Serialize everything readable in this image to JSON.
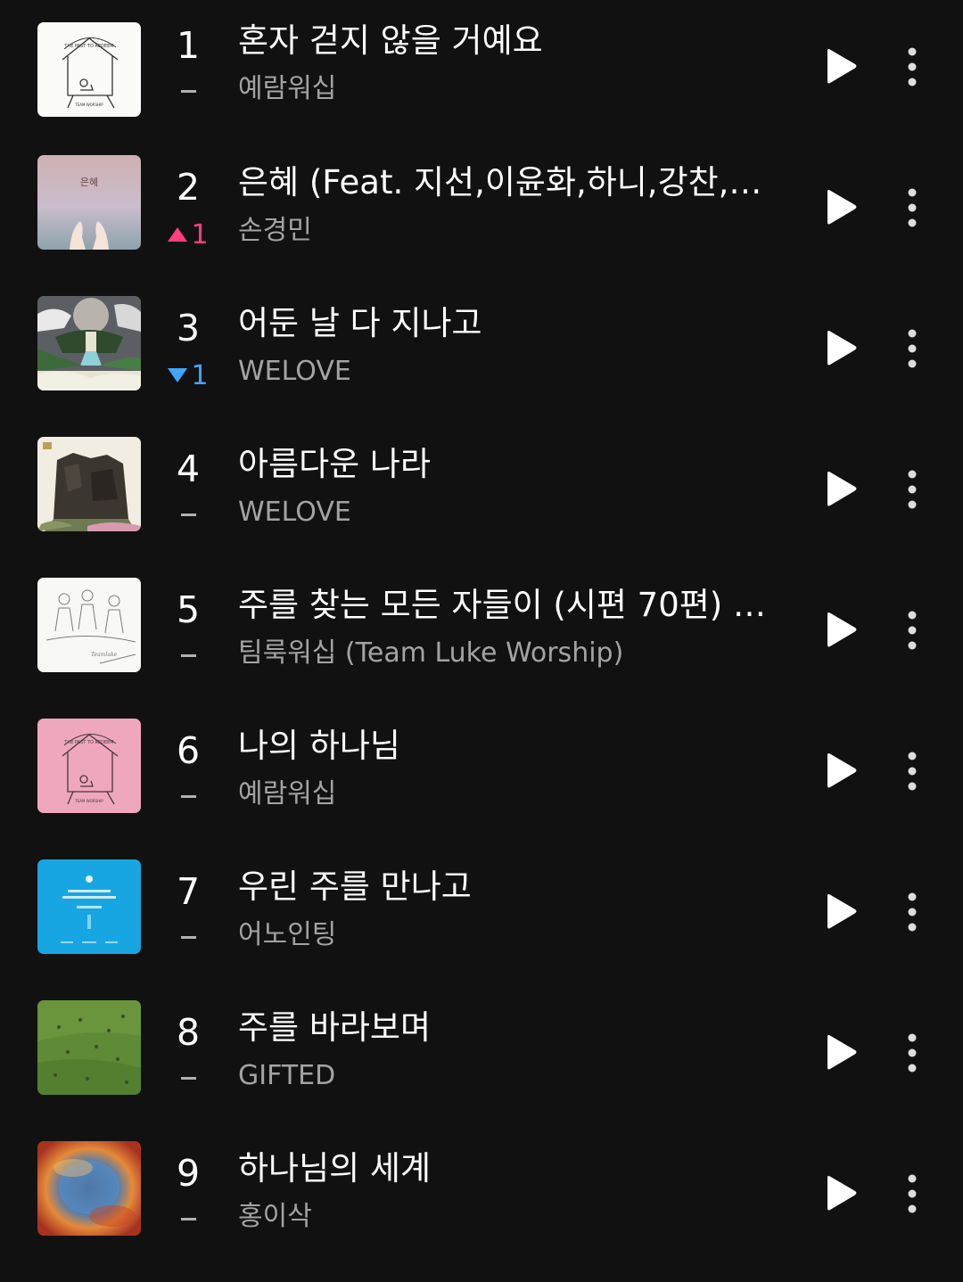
{
  "tracks": [
    {
      "rank": "1",
      "change": "",
      "direction": "flat",
      "title": "혼자 걷지 않을 거예요",
      "artist": "예람워십",
      "art": "house-white"
    },
    {
      "rank": "2",
      "change": "1",
      "direction": "up",
      "title": "은혜 (Feat. 지선,이윤화,하니,강찬,아…",
      "artist": "손경민",
      "art": "grace-hands"
    },
    {
      "rank": "3",
      "change": "1",
      "direction": "down",
      "title": "어둔 날 다 지나고",
      "artist": "WELOVE",
      "art": "moon-island"
    },
    {
      "rank": "4",
      "change": "",
      "direction": "flat",
      "title": "아름다운 나라",
      "artist": "WELOVE",
      "art": "castle-rock"
    },
    {
      "rank": "5",
      "change": "",
      "direction": "flat",
      "title": "주를 찾는 모든 자들이 (시편 70편) T…",
      "artist": "팀룩워십 (Team Luke Worship)",
      "art": "sketch-people"
    },
    {
      "rank": "6",
      "change": "",
      "direction": "flat",
      "title": "나의 하나님",
      "artist": "예람워십",
      "art": "house-pink"
    },
    {
      "rank": "7",
      "change": "",
      "direction": "flat",
      "title": "우린 주를 만나고",
      "artist": "어노인팅",
      "art": "anointing-blue"
    },
    {
      "rank": "8",
      "change": "",
      "direction": "flat",
      "title": "주를 바라보며",
      "artist": "GIFTED",
      "art": "green-field"
    },
    {
      "rank": "9",
      "change": "",
      "direction": "flat",
      "title": "하나님의 세계",
      "artist": "홍이삭",
      "art": "nebula-world"
    }
  ],
  "colors": {
    "background": "#111111",
    "up": "#ff3d7f",
    "down": "#3ea6ff",
    "secondary_text": "#a3a3a3"
  },
  "icons": {
    "play": "play-icon",
    "more": "more-vertical-icon"
  }
}
